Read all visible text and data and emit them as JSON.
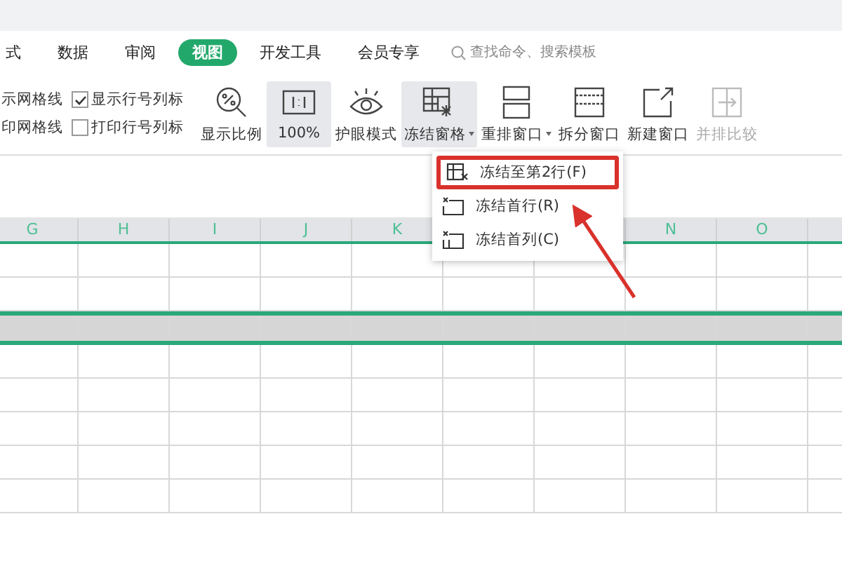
{
  "tabs": [
    {
      "label": "式",
      "selected": false
    },
    {
      "label": "数据",
      "selected": false
    },
    {
      "label": "审阅",
      "selected": false
    },
    {
      "label": "视图",
      "selected": true
    },
    {
      "label": "开发工具",
      "selected": false
    },
    {
      "label": "会员专享",
      "selected": false
    }
  ],
  "search": {
    "placeholder": "查找命令、搜索模板"
  },
  "options": [
    {
      "label": "示网格线"
    },
    {
      "label": "显示行号列标",
      "checked": true
    },
    {
      "label": "印网格线"
    },
    {
      "label": "打印行号列标",
      "checked": false
    }
  ],
  "tools": [
    {
      "kind": "zoom",
      "label": "显示比例",
      "active": false,
      "dropdown": false,
      "disabled": false
    },
    {
      "kind": "actual",
      "label": "100%",
      "active": true,
      "dropdown": false,
      "disabled": false
    },
    {
      "kind": "eye",
      "label": "护眼模式",
      "active": false,
      "dropdown": false,
      "disabled": false
    },
    {
      "kind": "freeze",
      "label": "冻结窗格",
      "active": true,
      "dropdown": true,
      "disabled": false
    },
    {
      "kind": "arrange",
      "label": "重排窗口",
      "active": false,
      "dropdown": true,
      "disabled": false
    },
    {
      "kind": "split",
      "label": "拆分窗口",
      "active": false,
      "dropdown": false,
      "disabled": false
    },
    {
      "kind": "newwin",
      "label": "新建窗口",
      "active": false,
      "dropdown": false,
      "disabled": false
    },
    {
      "kind": "compare",
      "label": "并排比较",
      "active": false,
      "dropdown": false,
      "disabled": true
    }
  ],
  "menu": [
    {
      "kind": "rows",
      "label": "冻结至第2行(F)",
      "selected": true
    },
    {
      "kind": "firstrow",
      "label": "冻结首行(R)",
      "selected": false
    },
    {
      "kind": "firstcol",
      "label": "冻结首列(C)",
      "selected": false
    }
  ],
  "columns": [
    "G",
    "H",
    "I",
    "J",
    "K",
    null,
    null,
    "N",
    "O",
    null
  ],
  "rows": [
    {
      "frozen": false
    },
    {
      "frozen": false
    },
    {
      "frozen": true
    },
    {
      "frozen": false
    },
    {
      "frozen": false
    },
    {
      "frozen": false
    },
    {
      "frozen": false
    },
    {
      "frozen": false
    }
  ]
}
